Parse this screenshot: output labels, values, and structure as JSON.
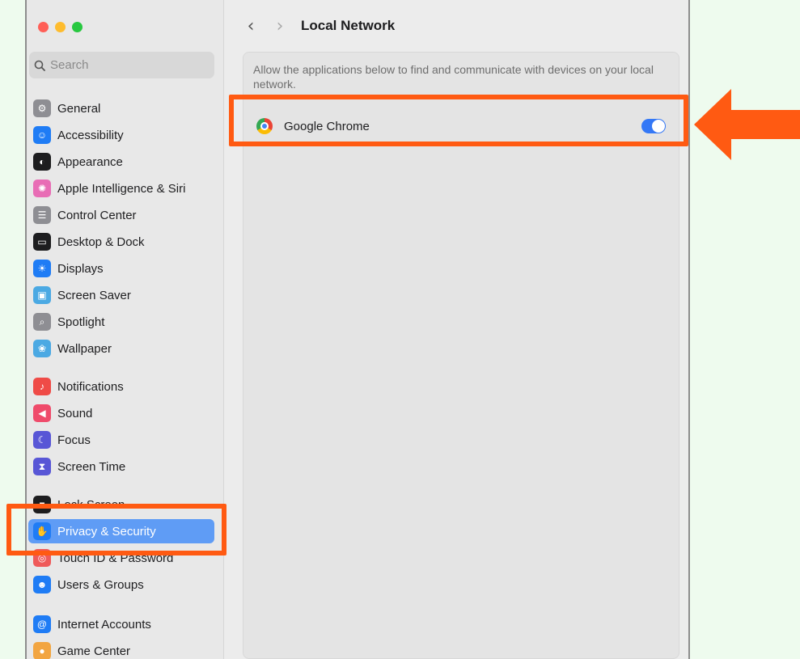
{
  "window": {
    "traffic_lights": {
      "close": "#ff5f57",
      "minimize": "#febc2e",
      "zoom": "#28c840"
    }
  },
  "search": {
    "placeholder": "Search"
  },
  "sidebar": {
    "items": [
      {
        "label": "General",
        "icon": "gear-icon",
        "color": "#8e8e93"
      },
      {
        "label": "Accessibility",
        "icon": "accessibility-icon",
        "color": "#1f7cf5"
      },
      {
        "label": "Appearance",
        "icon": "appearance-icon",
        "color": "#1d1d1f"
      },
      {
        "label": "Apple Intelligence & Siri",
        "icon": "siri-icon",
        "color": "#e86db5"
      },
      {
        "label": "Control Center",
        "icon": "control-center-icon",
        "color": "#8e8e93"
      },
      {
        "label": "Desktop & Dock",
        "icon": "dock-icon",
        "color": "#1d1d1f"
      },
      {
        "label": "Displays",
        "icon": "sun-icon",
        "color": "#1f7cf5"
      },
      {
        "label": "Screen Saver",
        "icon": "screen-saver-icon",
        "color": "#4ba9e3"
      },
      {
        "label": "Spotlight",
        "icon": "magnifier-icon",
        "color": "#8e8e93"
      },
      {
        "label": "Wallpaper",
        "icon": "wallpaper-icon",
        "color": "#4ba9e3"
      },
      {
        "label": "Notifications",
        "icon": "bell-icon",
        "color": "#ef4b47"
      },
      {
        "label": "Sound",
        "icon": "speaker-icon",
        "color": "#ef4b6b"
      },
      {
        "label": "Focus",
        "icon": "moon-icon",
        "color": "#5856d6"
      },
      {
        "label": "Screen Time",
        "icon": "hourglass-icon",
        "color": "#5856d6"
      },
      {
        "label": "Lock Screen",
        "icon": "lock-icon",
        "color": "#1d1d1f"
      },
      {
        "label": "Privacy & Security",
        "icon": "hand-icon",
        "color": "#1f7cf5",
        "selected": true
      },
      {
        "label": "Touch ID & Password",
        "icon": "fingerprint-icon",
        "color": "#ef5a5a"
      },
      {
        "label": "Users & Groups",
        "icon": "users-icon",
        "color": "#1f7cf5"
      },
      {
        "label": "Internet Accounts",
        "icon": "at-icon",
        "color": "#1f7cf5"
      },
      {
        "label": "Game Center",
        "icon": "game-center-icon",
        "color": "#f2a541"
      }
    ]
  },
  "main": {
    "back_label": "‹",
    "forward_label": "›",
    "title": "Local Network",
    "description": "Allow the applications below to find and communicate with devices on your local network.",
    "apps": [
      {
        "name": "Google Chrome",
        "icon": "chrome-icon",
        "enabled": true
      }
    ]
  },
  "colors": {
    "highlight": "#ff5a12",
    "toggle_on": "#3478f6",
    "selection": "#5f9cf5"
  }
}
